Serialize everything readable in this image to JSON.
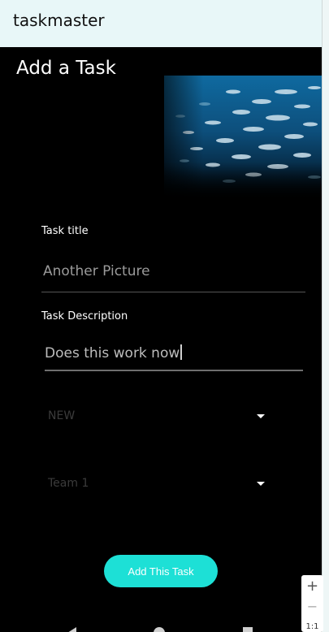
{
  "app_bar": {
    "title": "taskmaster"
  },
  "page": {
    "heading": "Add a Task"
  },
  "image": {
    "description_name": "fish-school-image"
  },
  "form": {
    "title_label": "Task title",
    "title_value": "Another Picture",
    "description_label": "Task Description",
    "description_value": "Does this work now",
    "status_selected": "NEW",
    "team_selected": "Team 1"
  },
  "actions": {
    "submit_label": "Add This Task"
  },
  "zoom": {
    "zoom_in": "+",
    "zoom_out": "−",
    "reset": "1:1"
  },
  "colors": {
    "accent": "#1de0d6",
    "app_bar_bg": "#e8f7f8",
    "background": "#000000"
  }
}
